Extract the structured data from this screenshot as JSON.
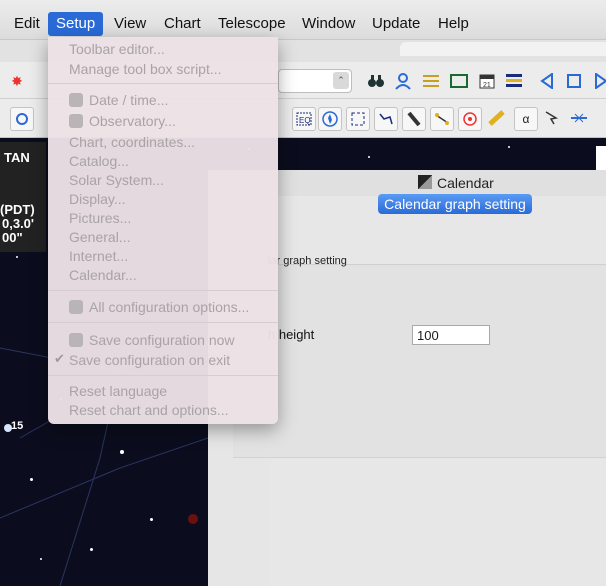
{
  "menubar": {
    "items": [
      "Edit",
      "Setup",
      "View",
      "Chart",
      "Telescope",
      "Window",
      "Update",
      "Help"
    ],
    "active": "Setup"
  },
  "setup_menu": {
    "items": [
      "Toolbar editor...",
      "Manage tool box script...",
      "Date / time...",
      "Observatory...",
      "Chart, coordinates...",
      "Catalog...",
      "Solar System...",
      "Display...",
      "Pictures...",
      "General...",
      "Internet...",
      "Calendar...",
      "All configuration options...",
      "Save configuration now",
      "Save configuration on exit",
      "Reset language",
      "Reset chart and options..."
    ],
    "checked_item": "Save configuration on exit"
  },
  "sky_info": {
    "projection": "TAN",
    "tz": "(PDT)",
    "coord1": "0,3.0'",
    "coord2": "00\"",
    "star_label": "15"
  },
  "calendar": {
    "window_title": "Calendar",
    "tab_label": "Calendar graph setting",
    "group_label": "lar graph setting",
    "height_label": "h height",
    "height_value": "100"
  },
  "colors": {
    "accent": "#2a6ad7",
    "sky": "#0b0d1e"
  }
}
